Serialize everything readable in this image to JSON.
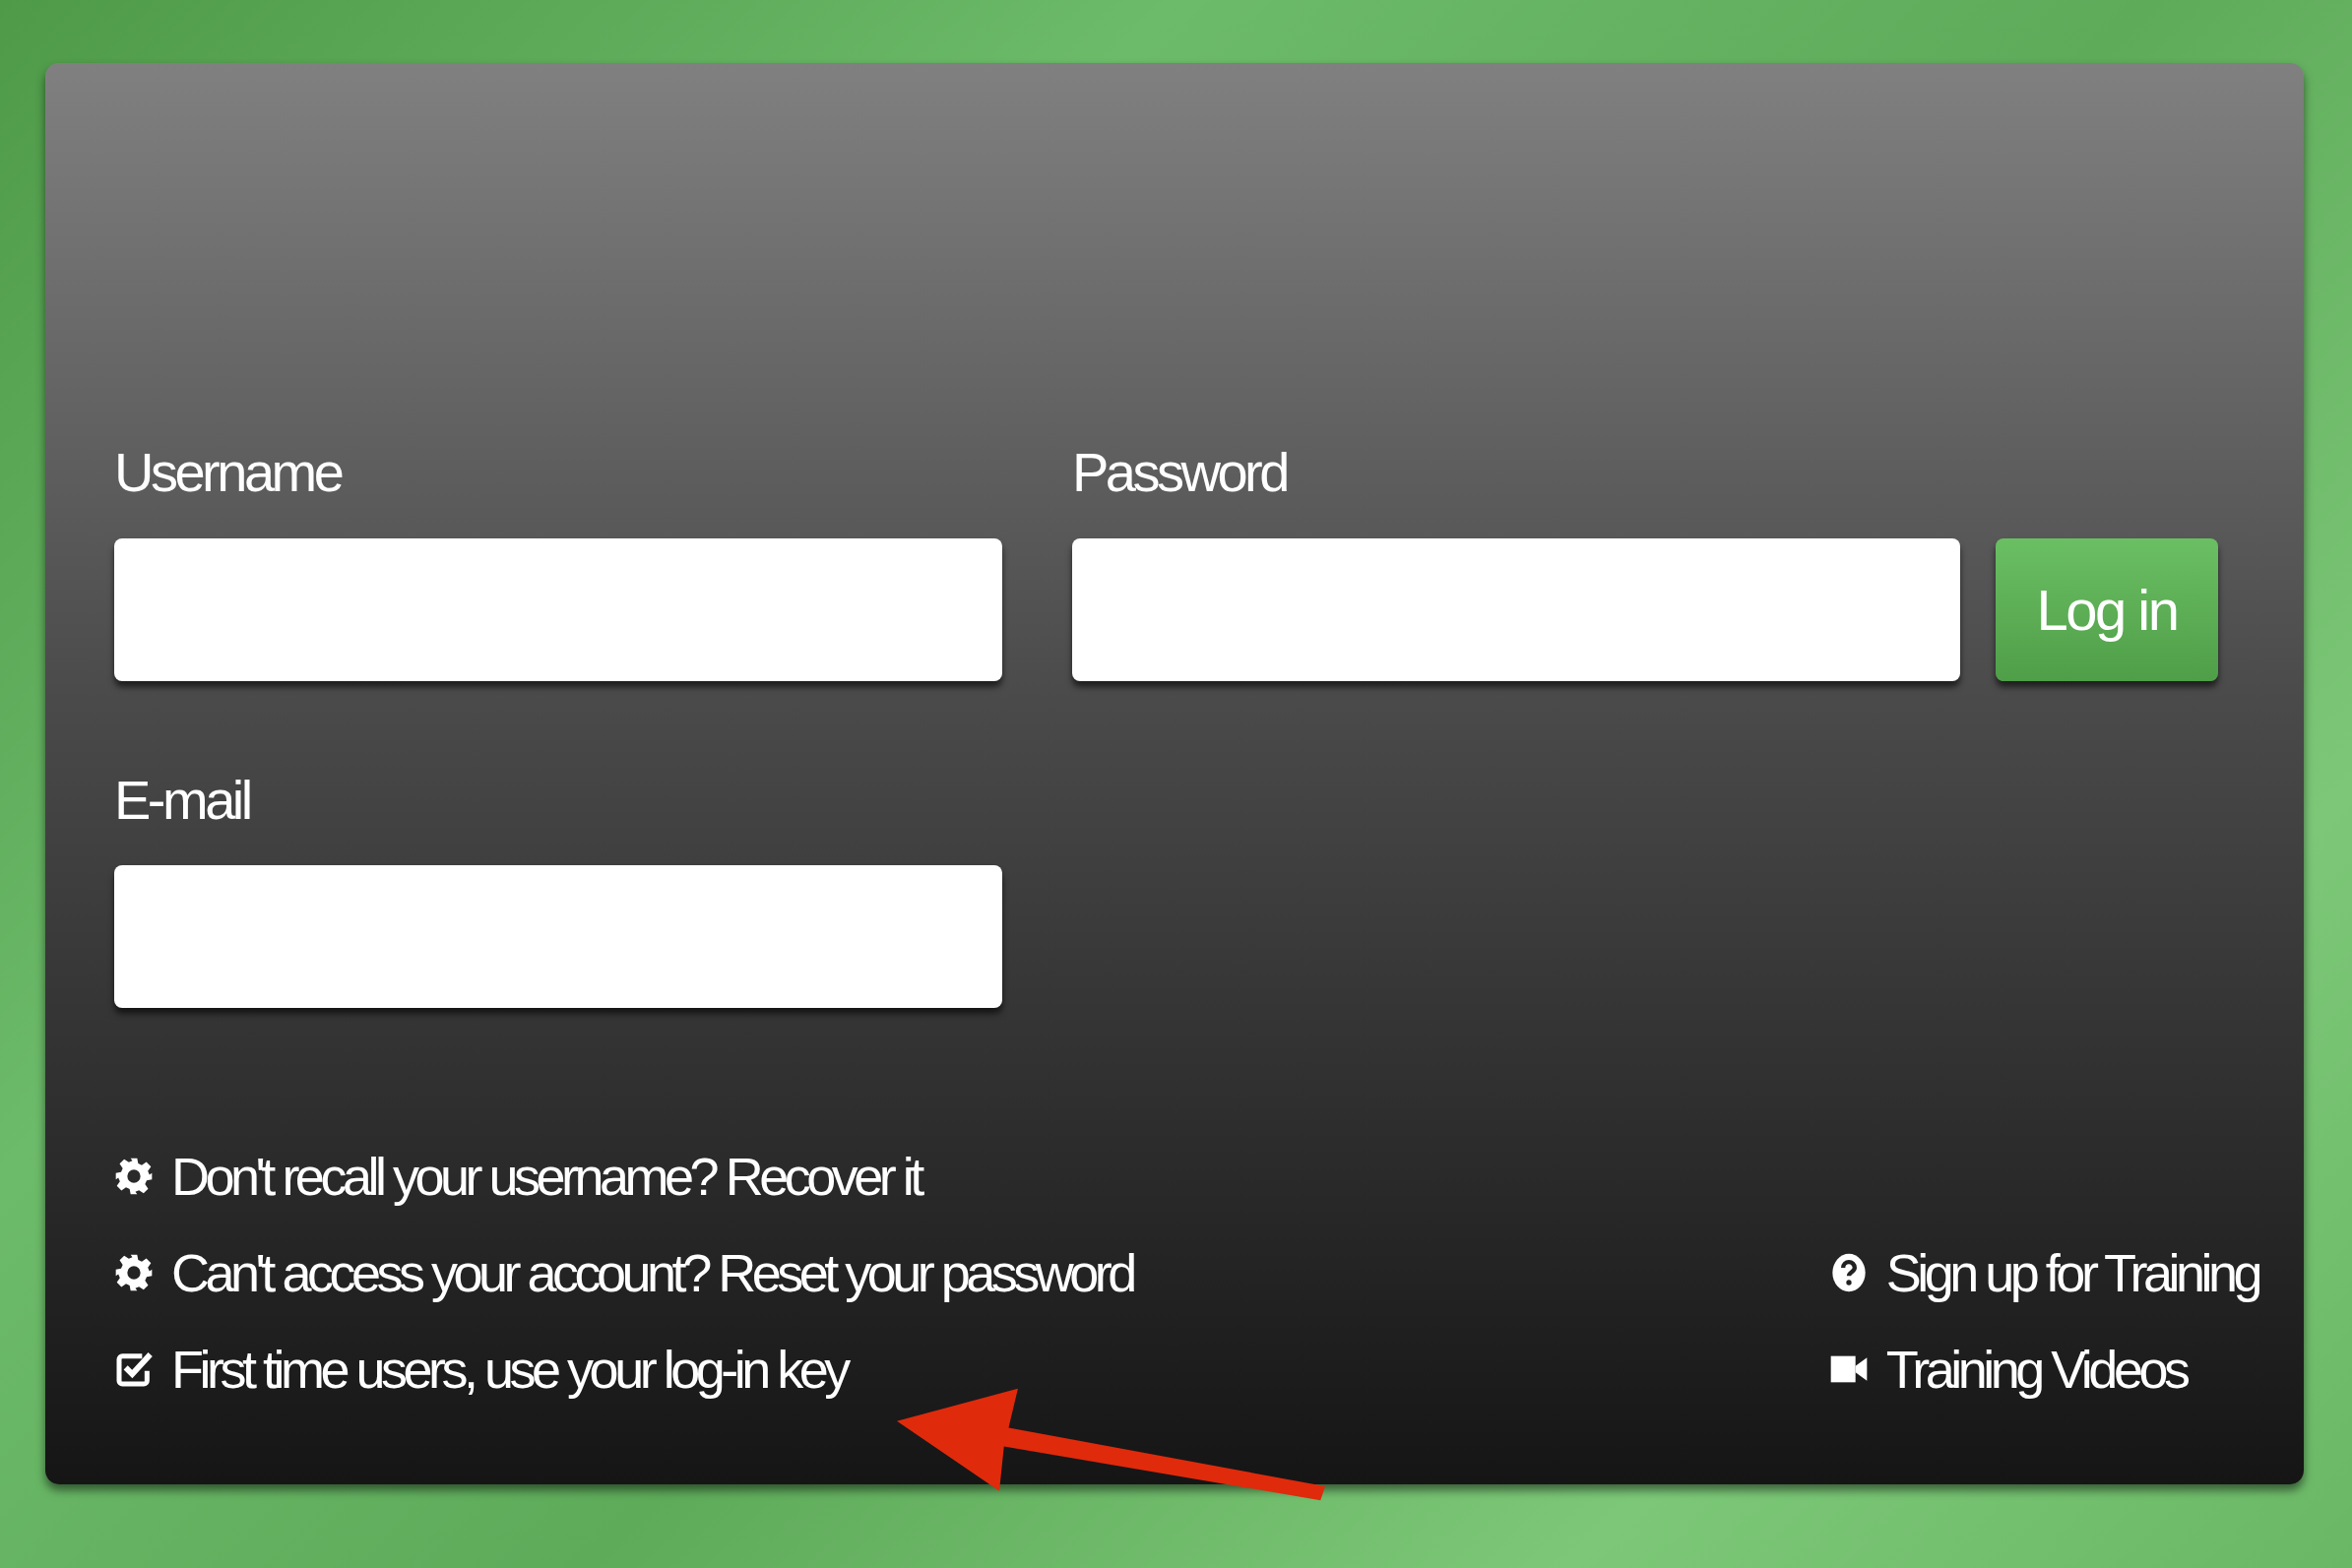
{
  "fields": [
    {
      "label": "Username"
    },
    {
      "label": "Password"
    },
    {
      "label": "E-mail"
    }
  ],
  "login_button": {
    "label": "Log in"
  },
  "help_links": [
    {
      "kind": "gear",
      "text": "Don't recall your username? Recover it"
    },
    {
      "kind": "gear",
      "text": "Can't access your account? Reset your password"
    },
    {
      "kind": "check",
      "text": "First time users, use your log-in key"
    }
  ],
  "training_links": [
    {
      "kind": "question",
      "text": "Sign up for Training"
    },
    {
      "kind": "video",
      "text": "Training Videos"
    }
  ]
}
